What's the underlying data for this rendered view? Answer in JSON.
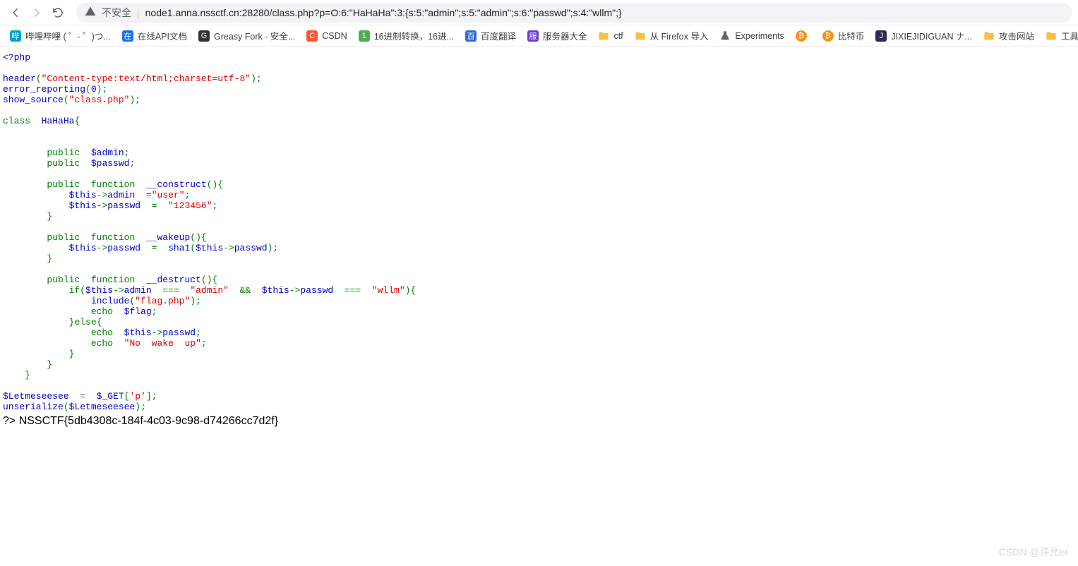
{
  "toolbar": {
    "insecure_label": "不安全",
    "url": "node1.anna.nssctf.cn:28280/class.php?p=O:6:\"HaHaHa\":3:{s:5:\"admin\";s:5:\"admin\";s:6:\"passwd\";s:4:\"wllm\";}"
  },
  "bookmarks": [
    {
      "label": "哔哩哔哩 ( ゜- ゜)つ...",
      "color": "#00a1d6"
    },
    {
      "label": "在线API文档",
      "color": "#1a73e8"
    },
    {
      "label": "Greasy Fork - 安全...",
      "color": "#333"
    },
    {
      "label": "CSDN",
      "color": "#fc5531"
    },
    {
      "label": "16进制转换，16进...",
      "color": "#4caf50"
    },
    {
      "label": "百度翻译",
      "color": "#2f6bdf"
    },
    {
      "label": "服务器大全",
      "color": "#6a3fcf"
    },
    {
      "label": "ctf",
      "color": "#f6c048",
      "folder": true
    },
    {
      "label": "从 Firefox 导入",
      "color": "#f6c048",
      "folder": true
    },
    {
      "label": "Experiments",
      "color": "#5f6368",
      "flask": true
    },
    {
      "label": "",
      "color": "#f7931a",
      "round": true
    },
    {
      "label": "比特币",
      "color": "#f7931a",
      "round": true
    },
    {
      "label": "JIXIEJIDIGUAN ナ...",
      "color": "#2c2c54"
    },
    {
      "label": "攻击网站",
      "color": "#f6c048",
      "folder": true
    },
    {
      "label": "工具",
      "color": "#f6c048",
      "folder": true
    }
  ],
  "code": {
    "php_open": "<?php",
    "header_fn": "header",
    "header_arg": "\"Content-type:text/html;charset=utf-8\"",
    "err_fn": "error_reporting",
    "err_arg": "0",
    "show_fn": "show_source",
    "show_arg": "\"class.php\"",
    "class_kw": "class",
    "class_name": "HaHaHa",
    "lbrace": "{",
    "rbrace": "}",
    "public_kw": "public",
    "function_kw": "function",
    "var_admin": "$admin",
    "var_passwd": "$passwd",
    "fn_construct": "__construct",
    "fn_wakeup": "__wakeup",
    "fn_destruct": "__destruct",
    "this": "$this",
    "arrow": "->",
    "admin_prop": "admin",
    "passwd_prop": "passwd",
    "eq": "=",
    "eqeqeq": "===",
    "and": "&&",
    "str_user": "\"user\"",
    "str_123456": "\"123456\"",
    "str_admin": "\"admin\"",
    "str_wllm": "\"wllm\"",
    "sha1_fn": "sha1",
    "if_kw": "if",
    "include_fn": "include",
    "include_arg": "\"flag.php\"",
    "echo_kw": "echo",
    "var_flag": "$flag",
    "else_kw": "else",
    "str_no_wake": "\"No  wake  up\"",
    "var_let": "$Letmeseesee",
    "get_arr": "$_GET",
    "get_key": "'p'",
    "unser_fn": "unserialize",
    "php_close": "?>",
    "flag_output": "NSSCTF{5db4308c-184f-4c03-9c98-d74266cc7d2f}"
  },
  "watermark": "CSDN @许允er"
}
